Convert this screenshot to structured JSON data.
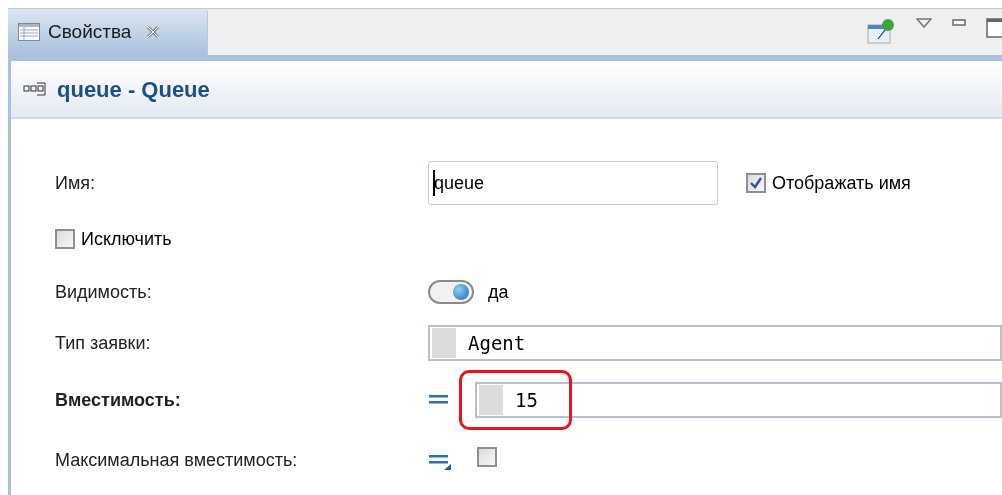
{
  "tab": {
    "label": "Свойства",
    "selected": true
  },
  "header": {
    "title": "queue - Queue"
  },
  "rows": [
    {
      "kind": "text",
      "label": "Имя:",
      "value": "queue",
      "checkbox": {
        "label": "Отображать имя",
        "checked": true
      }
    },
    {
      "kind": "checkbox",
      "label": "Исключить",
      "checked": false
    },
    {
      "kind": "toggle",
      "label": "Видимость:",
      "on": true,
      "value": "да"
    },
    {
      "kind": "type",
      "label": "Тип заявки:",
      "value": "Agent"
    },
    {
      "kind": "code",
      "label": "Вместимость:",
      "bold": true,
      "highlighted": true,
      "value": "15"
    },
    {
      "kind": "param-checkbox",
      "label": "Максимальная вместимость:",
      "checked": false
    }
  ]
}
